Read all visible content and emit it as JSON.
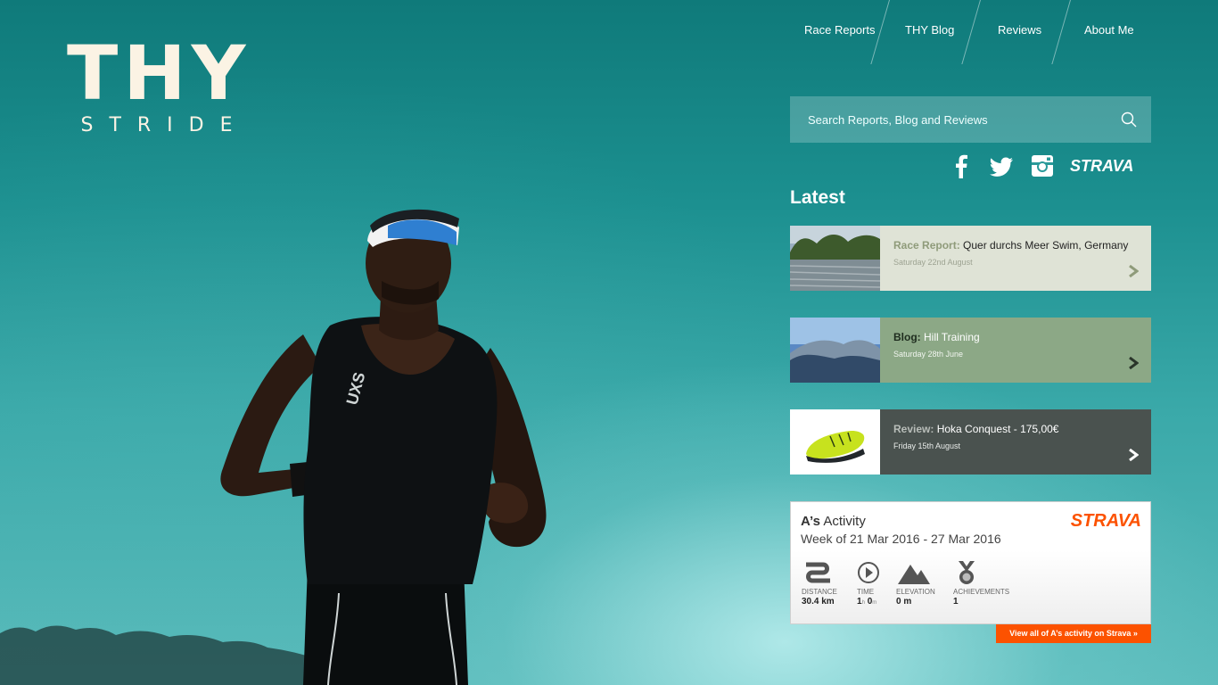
{
  "logo": {
    "main": "THY",
    "sub": "STRIDE"
  },
  "nav": {
    "items": [
      "Race Reports",
      "THY Blog",
      "Reviews",
      "About Me"
    ]
  },
  "search": {
    "placeholder": "Search Reports, Blog and Reviews"
  },
  "social": {
    "icons": [
      "facebook-icon",
      "twitter-icon",
      "instagram-icon",
      "strava-logo"
    ],
    "strava_label": "STRAVA"
  },
  "latest": {
    "heading": "Latest",
    "items": [
      {
        "type": "Race Report:",
        "title": "Quer durchs Meer Swim, Germany",
        "date": "Saturday 22nd August"
      },
      {
        "type": "Blog:",
        "title": "Hill Training",
        "date": "Saturday 28th June"
      },
      {
        "type": "Review:",
        "title": "Hoka Conquest - 175,00€",
        "date": "Friday 15th August"
      }
    ]
  },
  "strava": {
    "name": "A’s",
    "activity_word": "Activity",
    "week": "Week of 21 Mar 2016 - 27 Mar 2016",
    "logo": "STRAVA",
    "stats": {
      "distance": {
        "label": "DISTANCE",
        "value": "30.4 km"
      },
      "time": {
        "label": "TIME",
        "h": "1",
        "h_unit": "h",
        "m": "0",
        "m_unit": "m"
      },
      "elevation": {
        "label": "ELEVATION",
        "value": "0 m"
      },
      "achievements": {
        "label": "ACHIEVEMENTS",
        "value": "1"
      }
    },
    "link": "View all of A’s activity on Strava »"
  },
  "colors": {
    "strava_orange": "#fc5200",
    "logo_cream": "#fbf3e4",
    "card1_bg": "#dfe3d6",
    "card2_bg": "#8ca886",
    "card3_bg": "#4a524f"
  }
}
